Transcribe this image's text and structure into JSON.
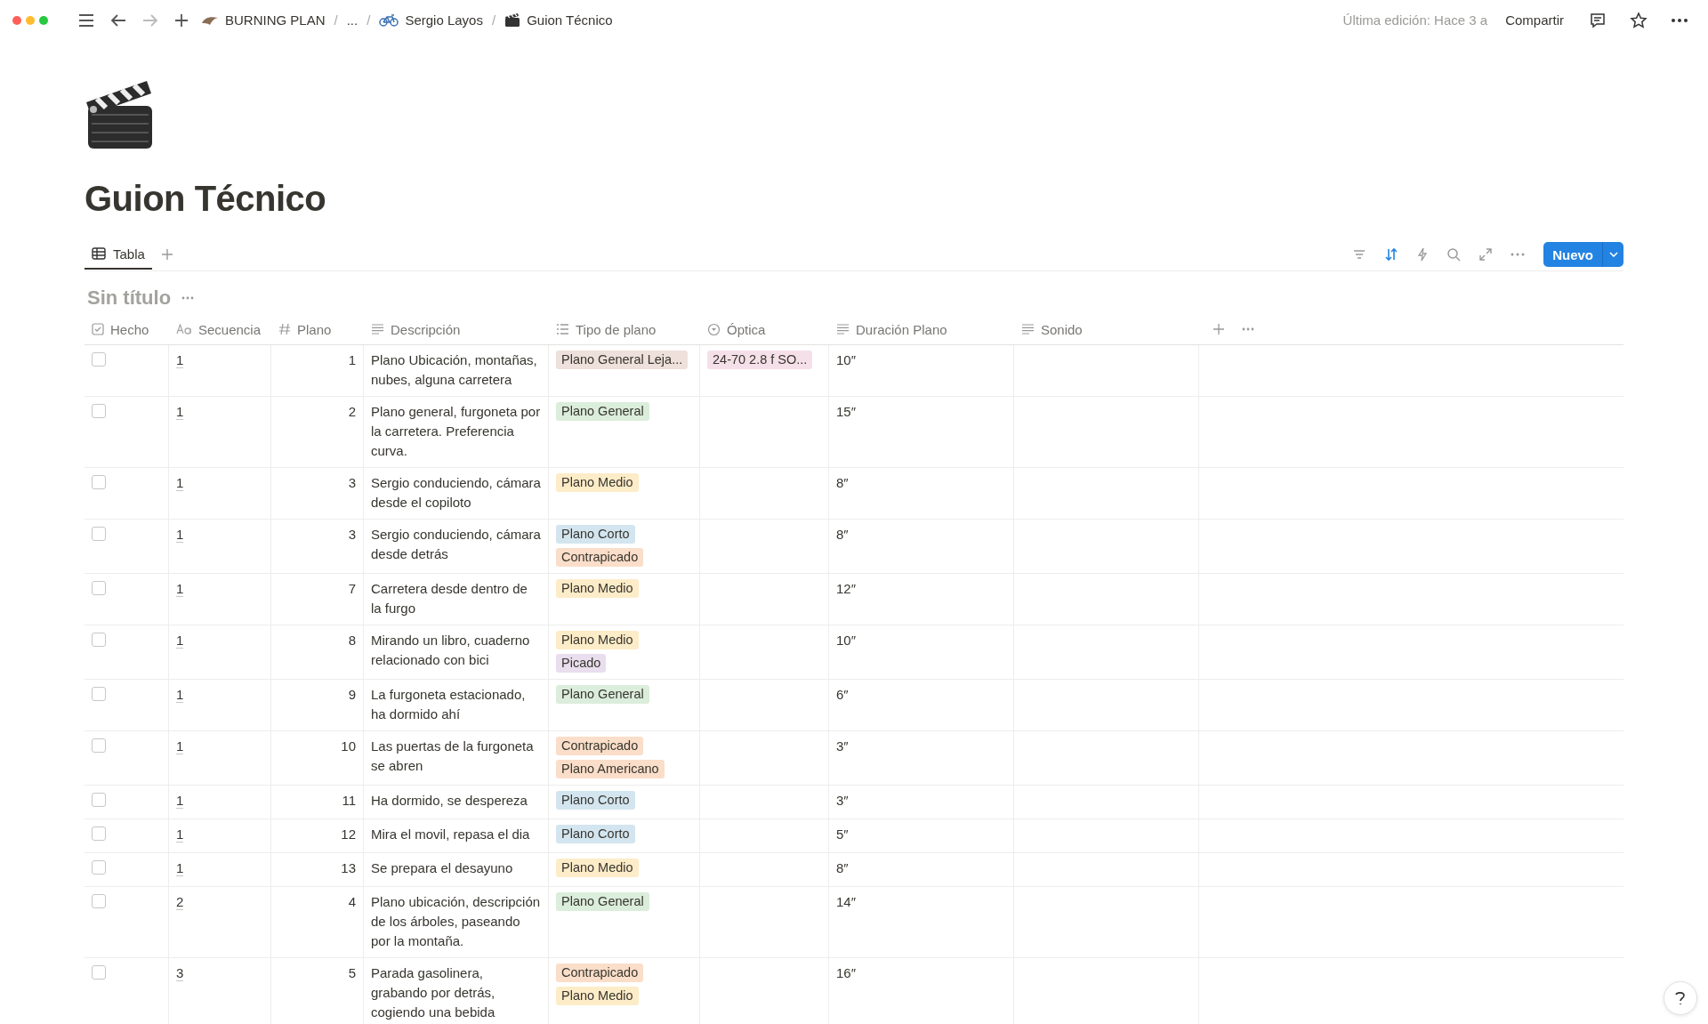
{
  "topbar": {
    "breadcrumbs": [
      {
        "label": "BURNING PLAN",
        "kind": "workspace"
      },
      {
        "label": "...",
        "kind": "plain"
      },
      {
        "label": "Sergio Layos",
        "kind": "bike"
      },
      {
        "label": "Guion Técnico",
        "kind": "clapper"
      }
    ],
    "separator": "/",
    "last_edited": "Última edición: Hace 3 a",
    "share": "Compartir"
  },
  "page": {
    "title": "Guion Técnico"
  },
  "views": [
    {
      "label": "Tabla",
      "selected": true
    }
  ],
  "new_button": "Nuevo",
  "database": {
    "title": "Sin título",
    "columns": [
      {
        "label": "Hecho",
        "kind": "checkbox"
      },
      {
        "label": "Secuencia",
        "kind": "title"
      },
      {
        "label": "Plano",
        "kind": "number"
      },
      {
        "label": "Descripción",
        "kind": "text"
      },
      {
        "label": "Tipo de plano",
        "kind": "multi"
      },
      {
        "label": "Óptica",
        "kind": "select"
      },
      {
        "label": "Duración Plano",
        "kind": "text"
      },
      {
        "label": "Sonido",
        "kind": "text"
      }
    ],
    "rows": [
      {
        "checked": false,
        "secuencia": "1",
        "plano": "1",
        "descripcion": "Plano Ubicación, montañas, nubes, alguna carretera",
        "tipo": [
          {
            "label": "Plano General Leja...",
            "color": "#eee0da"
          }
        ],
        "optica": [
          {
            "label": "24-70 2.8 f SO...",
            "color": "#f5e0e9"
          }
        ],
        "duracion": "10″"
      },
      {
        "checked": false,
        "secuencia": "1",
        "plano": "2",
        "descripcion": "Plano general, furgoneta por la carretera. Preferencia curva.",
        "tipo": [
          {
            "label": "Plano General",
            "color": "#dbeddb"
          }
        ],
        "optica": [],
        "duracion": "15″"
      },
      {
        "checked": false,
        "secuencia": "1",
        "plano": "3",
        "descripcion": "Sergio conduciendo, cámara desde el copiloto",
        "tipo": [
          {
            "label": "Plano Medio",
            "color": "#fdecc8"
          }
        ],
        "optica": [],
        "duracion": "8″"
      },
      {
        "checked": false,
        "secuencia": "1",
        "plano": "3",
        "descripcion": "Sergio conduciendo, cámara desde detrás",
        "tipo": [
          {
            "label": "Plano Corto",
            "color": "#d3e5ef"
          },
          {
            "label": "Contrapicado",
            "color": "#fadec9"
          }
        ],
        "optica": [],
        "duracion": "8″"
      },
      {
        "checked": false,
        "secuencia": "1",
        "plano": "7",
        "descripcion": "Carretera desde dentro de la furgo",
        "tipo": [
          {
            "label": "Plano Medio",
            "color": "#fdecc8"
          }
        ],
        "optica": [],
        "duracion": "12″"
      },
      {
        "checked": false,
        "secuencia": "1",
        "plano": "8",
        "descripcion": "Mirando un libro, cuaderno relacionado con bici",
        "tipo": [
          {
            "label": "Plano Medio",
            "color": "#fdecc8"
          },
          {
            "label": "Picado",
            "color": "#e8deee"
          }
        ],
        "optica": [],
        "duracion": "10″"
      },
      {
        "checked": false,
        "secuencia": "1",
        "plano": "9",
        "descripcion": "La furgoneta estacionado, ha dormido ahí",
        "tipo": [
          {
            "label": "Plano General",
            "color": "#dbeddb"
          }
        ],
        "optica": [],
        "duracion": "6″"
      },
      {
        "checked": false,
        "secuencia": "1",
        "plano": "10",
        "descripcion": "Las puertas de la furgoneta se abren",
        "tipo": [
          {
            "label": "Contrapicado",
            "color": "#fadec9"
          },
          {
            "label": "Plano Americano",
            "color": "#fadec9"
          }
        ],
        "optica": [],
        "duracion": "3″"
      },
      {
        "checked": false,
        "secuencia": "1",
        "plano": "11",
        "descripcion": "Ha dormido, se despereza",
        "tipo": [
          {
            "label": "Plano Corto",
            "color": "#d3e5ef"
          }
        ],
        "optica": [],
        "duracion": "3″"
      },
      {
        "checked": false,
        "secuencia": "1",
        "plano": "12",
        "descripcion": "Mira el movil, repasa el dia",
        "tipo": [
          {
            "label": "Plano Corto",
            "color": "#d3e5ef"
          }
        ],
        "optica": [],
        "duracion": "5″"
      },
      {
        "checked": false,
        "secuencia": "1",
        "plano": "13",
        "descripcion": "Se prepara el desayuno",
        "tipo": [
          {
            "label": "Plano Medio",
            "color": "#fdecc8"
          }
        ],
        "optica": [],
        "duracion": "8″"
      },
      {
        "checked": false,
        "secuencia": "2",
        "plano": "4",
        "descripcion": "Plano ubicación, descripción de los árboles, paseando por la montaña.",
        "tipo": [
          {
            "label": "Plano General",
            "color": "#dbeddb"
          }
        ],
        "optica": [],
        "duracion": "14″"
      },
      {
        "checked": false,
        "secuencia": "3",
        "plano": "5",
        "descripcion": "Parada gasolinera, grabando por detrás, cogiendo una bebida",
        "tipo": [
          {
            "label": "Contrapicado",
            "color": "#fadec9"
          },
          {
            "label": "Plano Medio",
            "color": "#fdecc8"
          }
        ],
        "optica": [],
        "duracion": "16″"
      }
    ]
  }
}
